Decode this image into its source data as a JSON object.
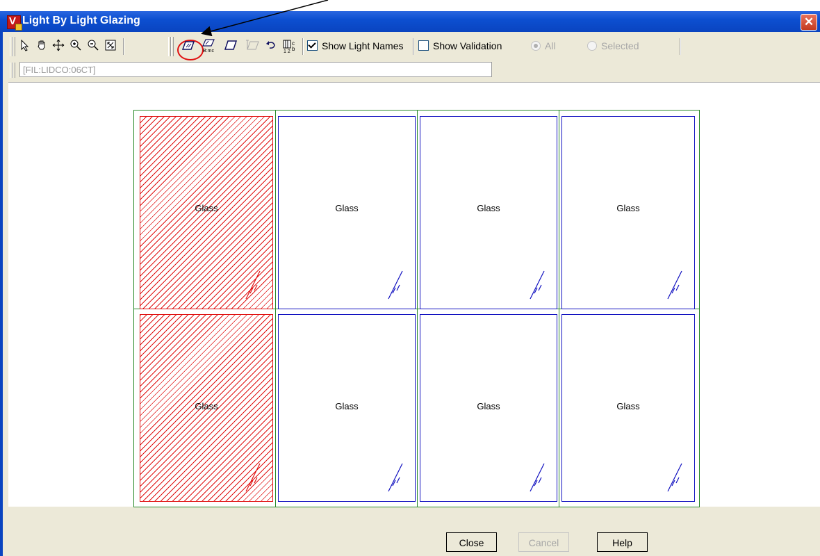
{
  "window": {
    "title": "Light By Light Glazing",
    "close_glyph": "✕"
  },
  "toolbar": {
    "icons": [
      "select-icon",
      "pan-icon",
      "move-icon",
      "zoom-in-icon",
      "zoom-out-icon",
      "zoom-extents-icon",
      "glazing-icon",
      "glazing-edit-icon",
      "glass-icon",
      "glass-disabled-icon",
      "undo-icon",
      "numbering-icon"
    ],
    "show_light_names": {
      "label": "Show Light Names",
      "checked": true
    },
    "show_validation": {
      "label": "Show Validation",
      "checked": false
    },
    "radio_all": {
      "label": "All",
      "selected": true,
      "enabled": false
    },
    "radio_selected": {
      "label": "Selected",
      "selected": false,
      "enabled": false
    }
  },
  "filter": {
    "value": "[FIL:LIDCO:06CT]"
  },
  "lights": [
    {
      "label": "Glass",
      "selected": true
    },
    {
      "label": "Glass",
      "selected": false
    },
    {
      "label": "Glass",
      "selected": false
    },
    {
      "label": "Glass",
      "selected": false
    },
    {
      "label": "Glass",
      "selected": true
    },
    {
      "label": "Glass",
      "selected": false
    },
    {
      "label": "Glass",
      "selected": false
    },
    {
      "label": "Glass",
      "selected": false
    }
  ],
  "buttons": {
    "close": "Close",
    "cancel": "Cancel",
    "help": "Help"
  },
  "colors": {
    "title_bar": "#0a44c0",
    "selected_light": "#e01010",
    "unselected_light": "#1010c0",
    "grid": "#2a8a2a",
    "highlight_circle": "#e01010"
  }
}
